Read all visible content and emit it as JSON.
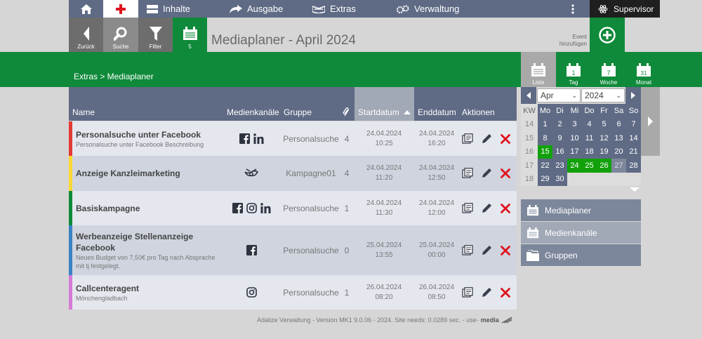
{
  "topnav": {
    "inhalte": "Inhalte",
    "ausgabe": "Ausgabe",
    "extras": "Extras",
    "verwaltung": "Verwaltung",
    "user": "Supervisor"
  },
  "toolbar": {
    "back": "Zurück",
    "search": "Suche",
    "filter": "Filter",
    "count": "5",
    "title": "Mediaplaner - April 2024",
    "event_line1": "Event",
    "event_line2": "hinzufügen"
  },
  "breadcrumb": "Extras > Mediaplaner",
  "views": {
    "liste": "Liste",
    "tag": "Tag",
    "woche": "Woche",
    "monat": "Monat",
    "tag_num": "1",
    "woche_num": "7",
    "monat_num": "31"
  },
  "table": {
    "headers": {
      "name": "Name",
      "media": "Medienkanäle",
      "group": "Gruppe",
      "start": "Startdatum",
      "end": "Enddatum",
      "actions": "Aktionen"
    },
    "rows": [
      {
        "name": "Personalsuche unter Facebook",
        "desc": "Personalsuche unter Facebook Beschreibung",
        "group": "Personalsuche",
        "count": "4",
        "start_date": "24.04.2024",
        "start_time": "10:25",
        "end_date": "24.04.2024",
        "end_time": "16:20",
        "color": "#e53935",
        "icons": [
          "facebook-icon",
          "linkedin-icon"
        ]
      },
      {
        "name": "Anzeige Kanzleimarketing",
        "desc": "",
        "group": "Kampagne01",
        "count": "4",
        "start_date": "24.04.2024",
        "start_time": "11:20",
        "end_date": "24.04.2024",
        "end_time": "12:50",
        "color": "#fdd835",
        "icons": [
          "post-horn-icon"
        ]
      },
      {
        "name": "Basiskampagne",
        "desc": "",
        "group": "Personalsuche",
        "count": "1",
        "start_date": "24.04.2024",
        "start_time": "11:30",
        "end_date": "24.04.2024",
        "end_time": "12:00",
        "color": "#0f8a3a",
        "icons": [
          "facebook-icon",
          "instagram-icon",
          "linkedin-icon"
        ]
      },
      {
        "name": "Werbeanzeige Stellenanzeige Facebook",
        "desc": "Neues Budget von 7,50€ pro Tag nach Absprache mit tj festgelegt.",
        "group": "Personalsuche",
        "count": "0",
        "start_date": "25.04.2024",
        "start_time": "13:55",
        "end_date": "25.04.2024",
        "end_time": "00:00",
        "color": "#3b82c4",
        "icons": [
          "facebook-icon"
        ]
      },
      {
        "name": "Callcenteragent",
        "desc": "Mönchengladbach",
        "group": "Personalsuche",
        "count": "1",
        "start_date": "26.04.2024",
        "start_time": "08:20",
        "end_date": "26.04.2024",
        "end_time": "08:50",
        "color": "#d57ad6",
        "icons": [
          "instagram-icon"
        ]
      }
    ]
  },
  "calendar": {
    "month": "Apr",
    "year": "2024",
    "kw_label": "KW",
    "weekdays": [
      "Mo",
      "Di",
      "Mi",
      "Do",
      "Fr",
      "Sa",
      "So"
    ],
    "weeks": [
      {
        "kw": "14",
        "days": [
          "1",
          "2",
          "3",
          "4",
          "5",
          "6",
          "7"
        ]
      },
      {
        "kw": "15",
        "days": [
          "8",
          "9",
          "10",
          "11",
          "12",
          "13",
          "14"
        ]
      },
      {
        "kw": "16",
        "days": [
          "15",
          "16",
          "17",
          "18",
          "19",
          "20",
          "21"
        ]
      },
      {
        "kw": "17",
        "days": [
          "22",
          "23",
          "24",
          "25",
          "26",
          "27",
          "28"
        ]
      },
      {
        "kw": "18",
        "days": [
          "29",
          "30",
          "",
          "",
          "",
          "",
          ""
        ]
      }
    ],
    "event_days": [
      "15",
      "24",
      "25",
      "26"
    ],
    "outside_days": [
      "27"
    ]
  },
  "side_menu": [
    "Mediaplaner",
    "Medienkanäle",
    "Gruppen"
  ],
  "footer": {
    "text": "Adalize Verwaltung - Version MK1 9.0.06 - 2024. Site needs: 0.0289 sec. - use-",
    "brand": "media"
  },
  "colors": {
    "nav": "#5f6b85",
    "green": "#0f8a3a",
    "event": "#12a10a",
    "delete": "#e0141e"
  }
}
